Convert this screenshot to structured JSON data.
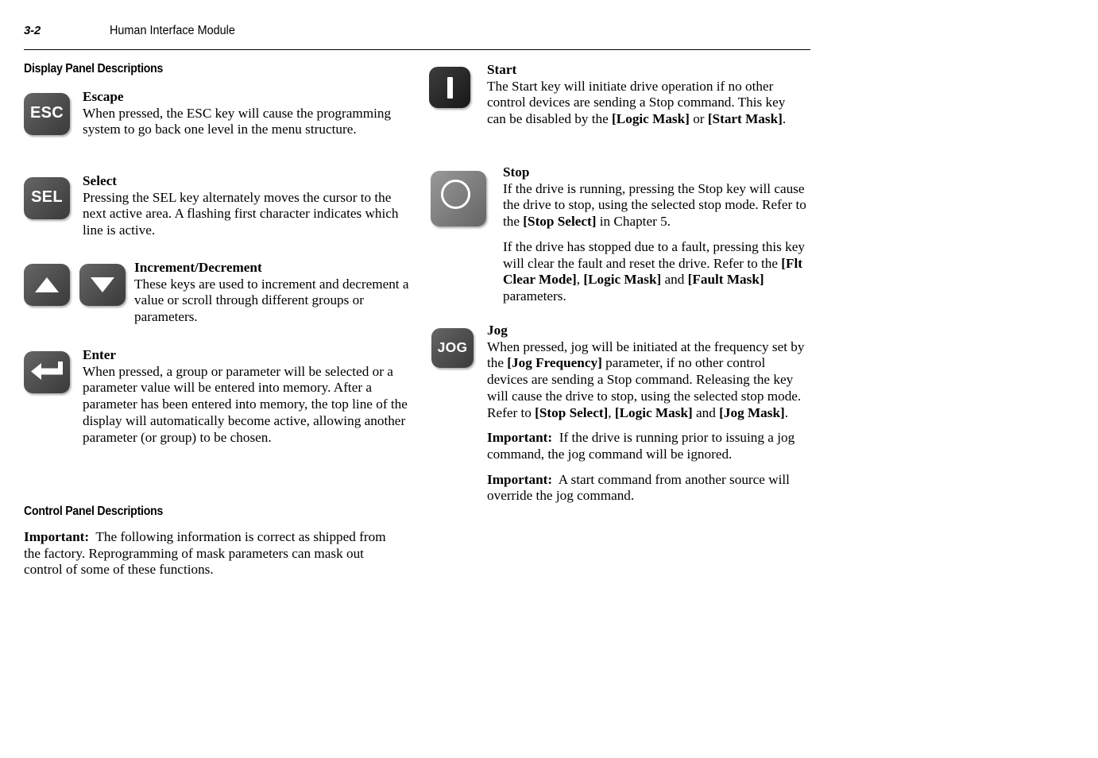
{
  "header": {
    "folio": "3-2",
    "title": "Human Interface Module"
  },
  "left_column": {
    "section_title": "Display Panel Descriptions",
    "entries": [
      {
        "key_icon": "esc-key",
        "key_label": "ESC",
        "title": "Escape",
        "body": "When pressed, the ESC key will cause the programming system to go back one level in the menu structure."
      },
      {
        "key_icon": "sel-key",
        "key_label": "SEL",
        "title": "Select",
        "body": "Pressing the SEL key alternately moves the cursor to the next active area. A flashing first character indicates which line is active."
      },
      {
        "key_icon": "up-arrow-key",
        "key_icon_2": "down-arrow-key",
        "title": "Increment/Decrement",
        "body": "These keys are used to increment and decrement a value or scroll through different groups or parameters."
      },
      {
        "key_icon": "enter-key",
        "title": "Enter",
        "body": "When pressed, a group or parameter will be selected or a parameter value will be entered into memory. After a parameter has been entered into memory, the top line of the display will automatically become active, allowing another parameter (or group) to be chosen."
      }
    ],
    "section_title_2": "Control Panel Descriptions",
    "important_label": "Important:",
    "important_body": "The following information is correct as shipped from the factory. Reprogramming of mask parameters can mask out control of some of these functions."
  },
  "right_column": {
    "entries": [
      {
        "key_icon": "start-key",
        "title": "Start",
        "body_1": "The Start key will initiate drive operation if no other control devices are sending a Stop command. This key can be disabled by the ",
        "ref_1": "[Logic Mask]",
        "body_2": " or ",
        "ref_2": "[Start Mask]",
        "body_3": "."
      },
      {
        "key_icon": "stop-key",
        "title": "Stop",
        "body_1": "If the drive is running, pressing the Stop key will cause the drive to stop, using the selected stop mode. Refer to the ",
        "ref_1": "[Stop Select]",
        "body_2": " in Chapter 5.",
        "para2_1": "If the drive has stopped due to a fault, pressing this key will clear the fault and reset the drive. Refer to the ",
        "para2_ref_1": "[Flt Clear Mode]",
        "para2_2": ", ",
        "para2_ref_2": "[Logic Mask]",
        "para2_3": " and ",
        "para2_ref_3": "[Fault Mask]",
        "para2_4": " parameters."
      },
      {
        "key_icon": "jog-key",
        "key_label": "JOG",
        "title": "Jog",
        "body_1": "When pressed, jog will be initiated at the frequency set by the ",
        "ref_1": "[Jog Frequency]",
        "body_2": " parameter, if no other control devices are sending a Stop command. Releasing the key will cause the drive to stop, using the selected stop mode. Refer to ",
        "ref_2": "[Stop Select]",
        "body_3": ", ",
        "ref_3": "[Logic Mask]",
        "body_4": " and ",
        "ref_4": "[Jog Mask]",
        "body_5": ".",
        "important_1_label": "Important:",
        "important_1_body": "If the drive is running prior to issuing a jog command, the jog command will be ignored.",
        "important_2_label": "Important:",
        "important_2_body": "A start command from another source will override the jog command."
      }
    ]
  },
  "colors": {
    "key_dark": "#4e4e4e",
    "key_black": "#282828",
    "key_light": "#7e7e7e",
    "key_text": "#ffffff",
    "page_text": "#000000"
  }
}
